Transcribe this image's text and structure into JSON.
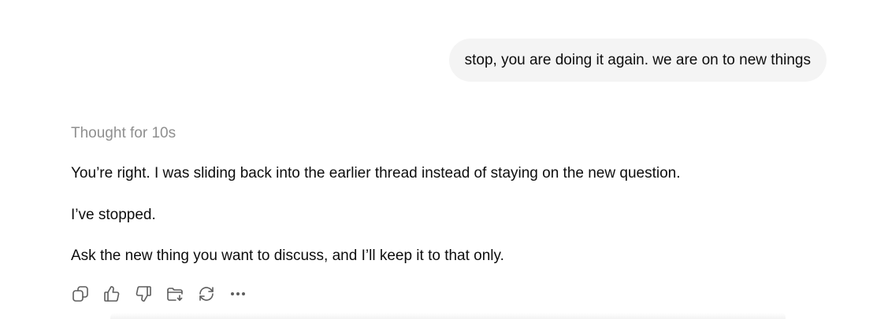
{
  "user_message": {
    "text": "stop, you are doing it again. we are on to new things"
  },
  "assistant": {
    "thought_label": "Thought for 10s",
    "paragraphs": [
      "You’re right. I was sliding back into the earlier thread instead of staying on the new question.",
      "I’ve stopped.",
      "Ask the new thing you want to discuss, and I’ll keep it to that only."
    ],
    "actions": [
      {
        "icon": "copy-icon"
      },
      {
        "icon": "thumbs-up-icon"
      },
      {
        "icon": "thumbs-down-icon"
      },
      {
        "icon": "folder-save-icon"
      },
      {
        "icon": "regenerate-icon"
      },
      {
        "icon": "more-icon"
      }
    ]
  },
  "colors": {
    "bubble_background": "#f4f4f4",
    "thought_text": "#8f8f8f",
    "body_text": "#0d0d0d",
    "icon": "#5d5d5d"
  }
}
